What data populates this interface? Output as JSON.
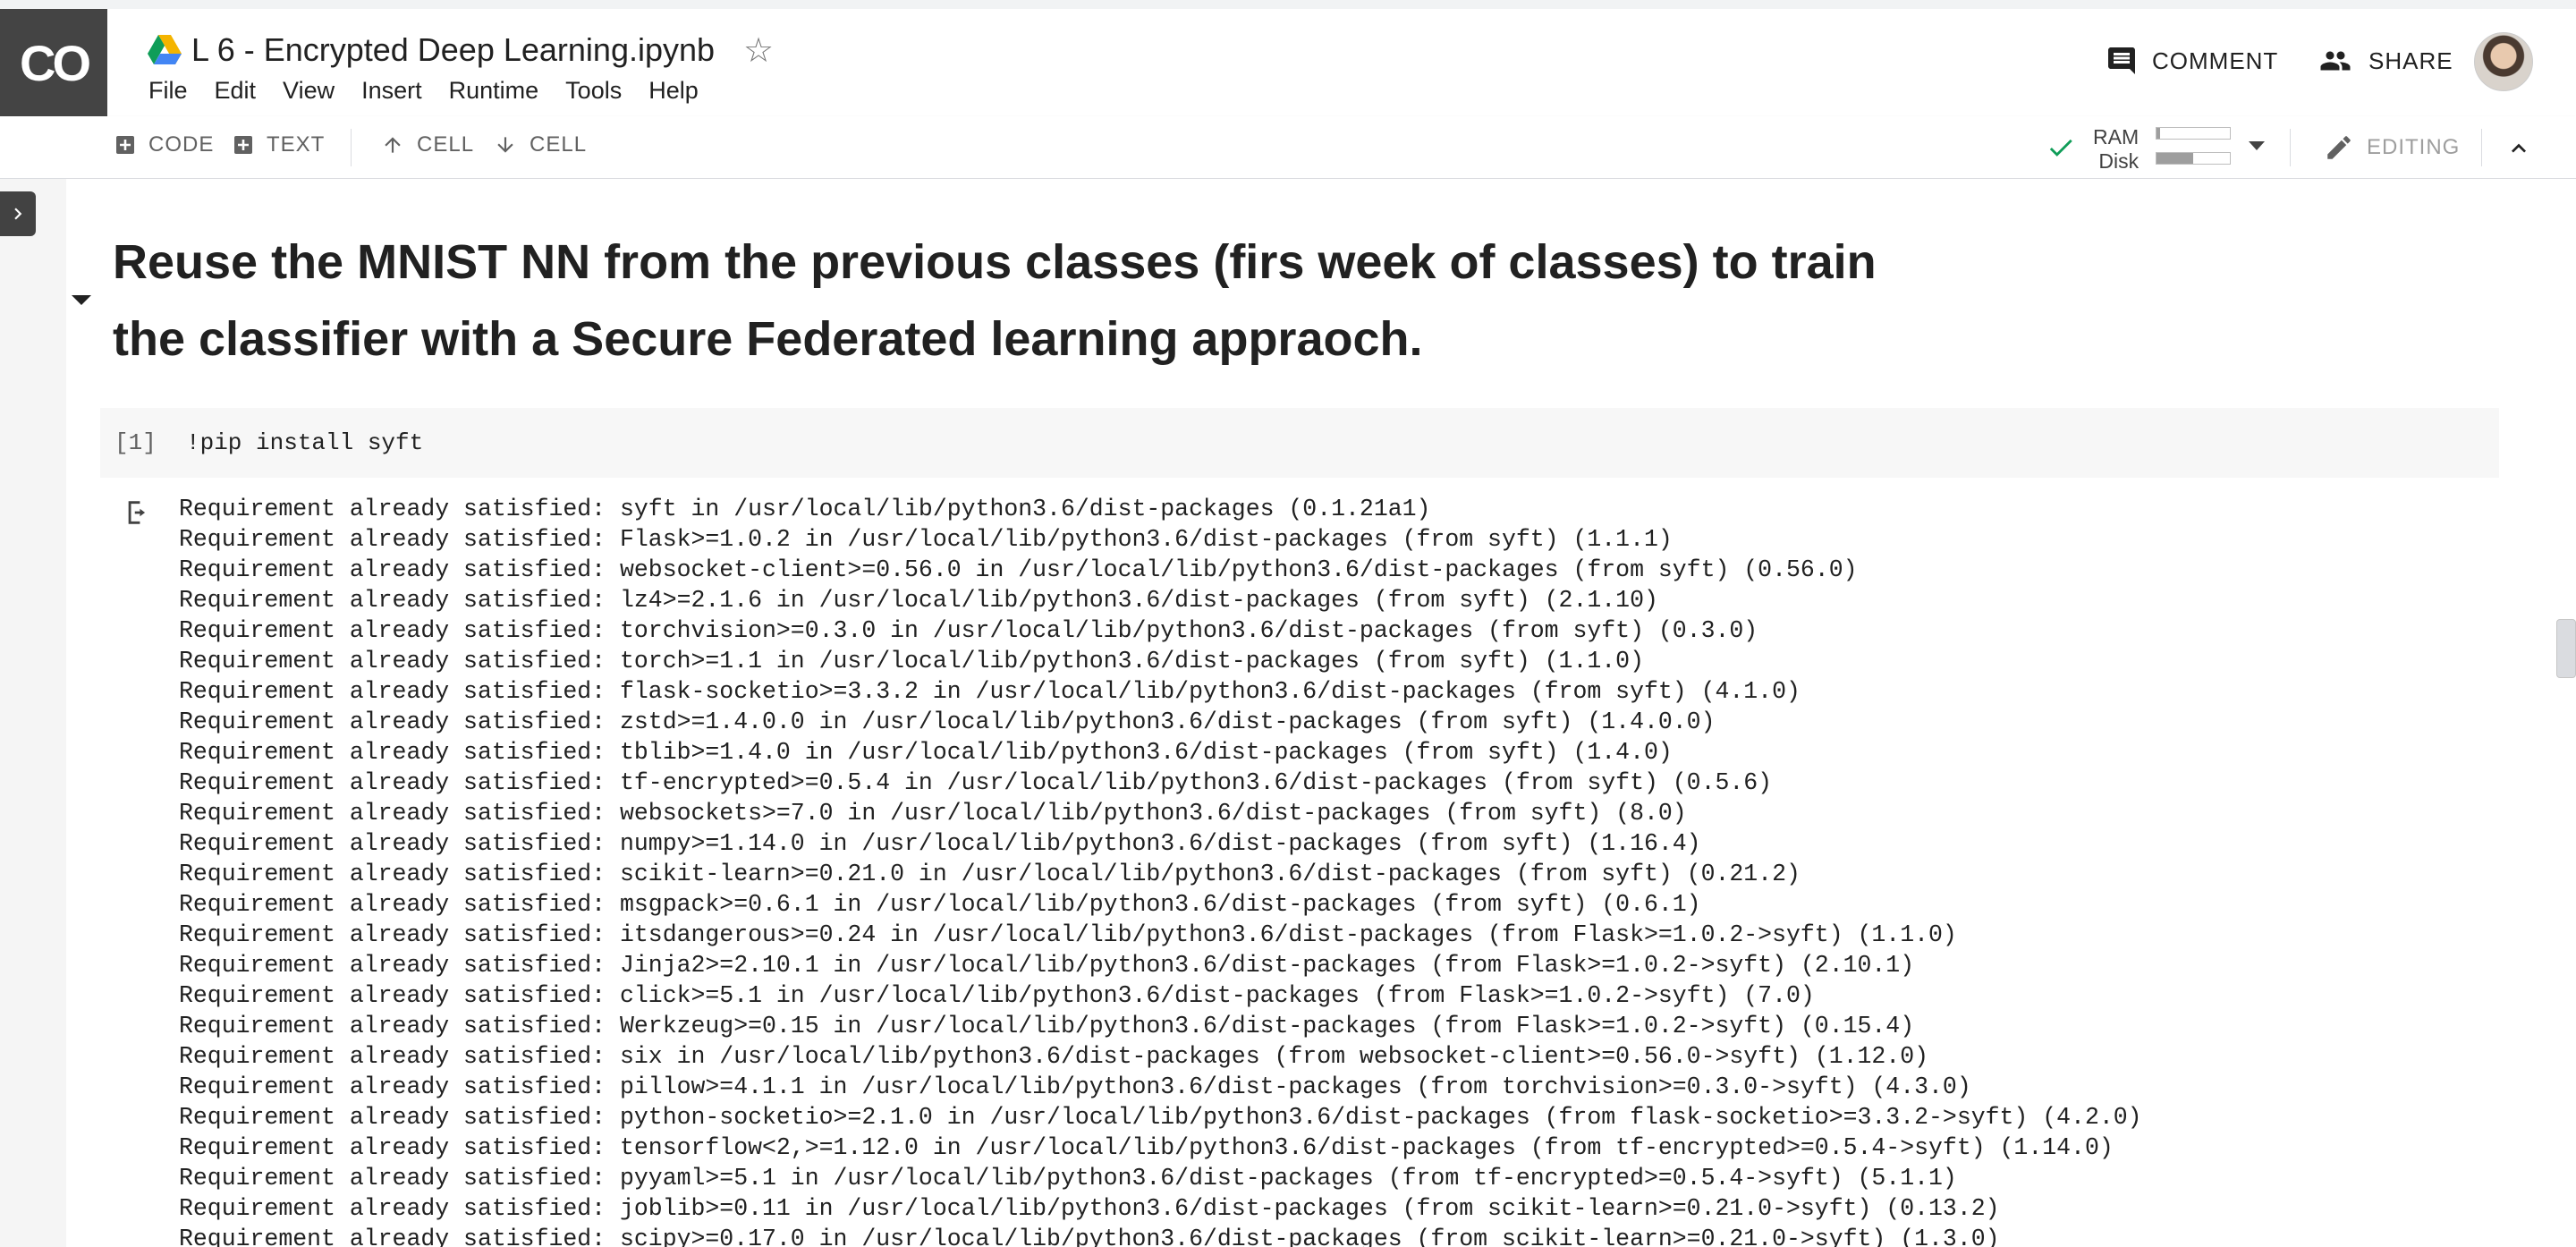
{
  "app": {
    "logo": "CO",
    "title": "L 6 - Encrypted Deep Learning.ipynb"
  },
  "menu": [
    "File",
    "Edit",
    "View",
    "Insert",
    "Runtime",
    "Tools",
    "Help"
  ],
  "header": {
    "comment_label": "COMMENT",
    "share_label": "SHARE"
  },
  "toolbar": {
    "add_code": "CODE",
    "add_text": "TEXT",
    "cell_up": "CELL",
    "cell_down": "CELL",
    "ram_label": "RAM",
    "disk_label": "Disk",
    "ram_usage": 0.05,
    "disk_usage": 0.5,
    "editing_label": "EDITING"
  },
  "notebook": {
    "heading_line1": "Reuse the MNIST NN from the previous classes (firs week of classes) to train",
    "heading_line2": "the classifier with a Secure Federated learning appraoch.",
    "cell": {
      "exec_count": "[1]",
      "code": "!pip install syft"
    },
    "output": [
      "Requirement already satisfied: syft in /usr/local/lib/python3.6/dist-packages (0.1.21a1)",
      "Requirement already satisfied: Flask>=1.0.2 in /usr/local/lib/python3.6/dist-packages (from syft) (1.1.1)",
      "Requirement already satisfied: websocket-client>=0.56.0 in /usr/local/lib/python3.6/dist-packages (from syft) (0.56.0)",
      "Requirement already satisfied: lz4>=2.1.6 in /usr/local/lib/python3.6/dist-packages (from syft) (2.1.10)",
      "Requirement already satisfied: torchvision>=0.3.0 in /usr/local/lib/python3.6/dist-packages (from syft) (0.3.0)",
      "Requirement already satisfied: torch>=1.1 in /usr/local/lib/python3.6/dist-packages (from syft) (1.1.0)",
      "Requirement already satisfied: flask-socketio>=3.3.2 in /usr/local/lib/python3.6/dist-packages (from syft) (4.1.0)",
      "Requirement already satisfied: zstd>=1.4.0.0 in /usr/local/lib/python3.6/dist-packages (from syft) (1.4.0.0)",
      "Requirement already satisfied: tblib>=1.4.0 in /usr/local/lib/python3.6/dist-packages (from syft) (1.4.0)",
      "Requirement already satisfied: tf-encrypted>=0.5.4 in /usr/local/lib/python3.6/dist-packages (from syft) (0.5.6)",
      "Requirement already satisfied: websockets>=7.0 in /usr/local/lib/python3.6/dist-packages (from syft) (8.0)",
      "Requirement already satisfied: numpy>=1.14.0 in /usr/local/lib/python3.6/dist-packages (from syft) (1.16.4)",
      "Requirement already satisfied: scikit-learn>=0.21.0 in /usr/local/lib/python3.6/dist-packages (from syft) (0.21.2)",
      "Requirement already satisfied: msgpack>=0.6.1 in /usr/local/lib/python3.6/dist-packages (from syft) (0.6.1)",
      "Requirement already satisfied: itsdangerous>=0.24 in /usr/local/lib/python3.6/dist-packages (from Flask>=1.0.2->syft) (1.1.0)",
      "Requirement already satisfied: Jinja2>=2.10.1 in /usr/local/lib/python3.6/dist-packages (from Flask>=1.0.2->syft) (2.10.1)",
      "Requirement already satisfied: click>=5.1 in /usr/local/lib/python3.6/dist-packages (from Flask>=1.0.2->syft) (7.0)",
      "Requirement already satisfied: Werkzeug>=0.15 in /usr/local/lib/python3.6/dist-packages (from Flask>=1.0.2->syft) (0.15.4)",
      "Requirement already satisfied: six in /usr/local/lib/python3.6/dist-packages (from websocket-client>=0.56.0->syft) (1.12.0)",
      "Requirement already satisfied: pillow>=4.1.1 in /usr/local/lib/python3.6/dist-packages (from torchvision>=0.3.0->syft) (4.3.0)",
      "Requirement already satisfied: python-socketio>=2.1.0 in /usr/local/lib/python3.6/dist-packages (from flask-socketio>=3.3.2->syft) (4.2.0)",
      "Requirement already satisfied: tensorflow<2,>=1.12.0 in /usr/local/lib/python3.6/dist-packages (from tf-encrypted>=0.5.4->syft) (1.14.0)",
      "Requirement already satisfied: pyyaml>=5.1 in /usr/local/lib/python3.6/dist-packages (from tf-encrypted>=0.5.4->syft) (5.1.1)",
      "Requirement already satisfied: joblib>=0.11 in /usr/local/lib/python3.6/dist-packages (from scikit-learn>=0.21.0->syft) (0.13.2)",
      "Requirement already satisfied: scipy>=0.17.0 in /usr/local/lib/python3.6/dist-packages (from scikit-learn>=0.21.0->syft) (1.3.0)"
    ]
  },
  "colors": {
    "logo_bg": "#444444",
    "check": "#0f9d58",
    "drive_green": "#0f9d58",
    "drive_yellow": "#f4b400",
    "drive_blue": "#4285f4"
  }
}
